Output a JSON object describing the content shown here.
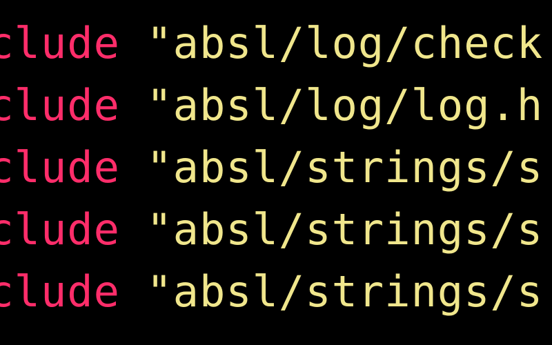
{
  "code": {
    "lines": [
      {
        "keyword": "nclude",
        "string": "\"absl/log/check"
      },
      {
        "keyword": "nclude",
        "string": "\"absl/log/log.h"
      },
      {
        "keyword": "nclude",
        "string": "\"absl/strings/s"
      },
      {
        "keyword": "nclude",
        "string": "\"absl/strings/s"
      },
      {
        "keyword": "nclude",
        "string": "\"absl/strings/s"
      }
    ]
  }
}
